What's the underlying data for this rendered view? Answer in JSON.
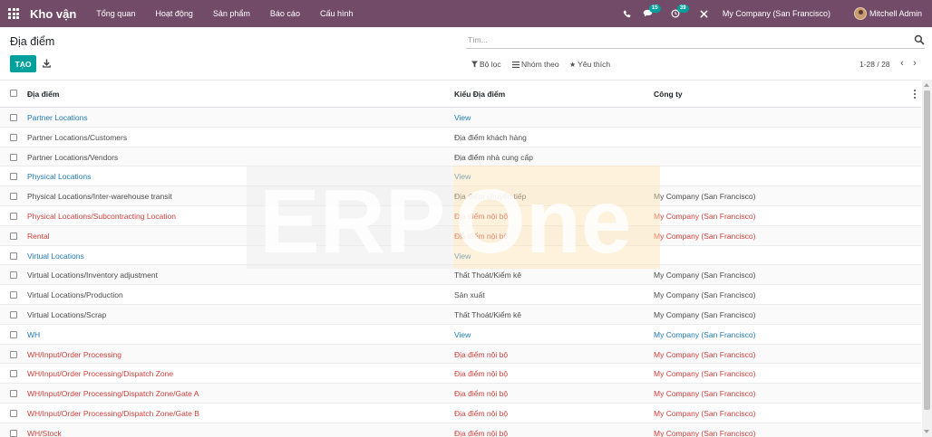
{
  "navbar": {
    "app_name": "Kho vận",
    "menu": [
      "Tổng quan",
      "Hoạt động",
      "Sản phẩm",
      "Báo cáo",
      "Cấu hình"
    ],
    "messages_count": "15",
    "activities_count": "39",
    "company": "My Company (San Francisco)",
    "user": "Mitchell Admin"
  },
  "control_panel": {
    "breadcrumb": "Địa điểm",
    "search_placeholder": "Tìm...",
    "create_label": "TẠO",
    "filters_label": "Bộ lọc",
    "group_by_label": "Nhóm theo",
    "favorites_label": "Yêu thích",
    "pager": "1-28 / 28"
  },
  "table": {
    "columns": [
      "Địa điểm",
      "Kiểu Địa điểm",
      "Công ty"
    ],
    "rows": [
      {
        "location": "Partner Locations",
        "type": "View",
        "company": "",
        "color": "#1f7ab8"
      },
      {
        "location": "Partner Locations/Customers",
        "type": "Địa điểm khách hàng",
        "company": "",
        "color": "#4c4c4c"
      },
      {
        "location": "Partner Locations/Vendors",
        "type": "Địa điểm nhà cung cấp",
        "company": "",
        "color": "#4c4c4c"
      },
      {
        "location": "Physical Locations",
        "type": "View",
        "company": "",
        "color": "#1f7ab8"
      },
      {
        "location": "Physical Locations/Inter-warehouse transit",
        "type": "Địa điểm chuyển tiếp",
        "company": "My Company (San Francisco)",
        "color": "#4c4c4c"
      },
      {
        "location": "Physical Locations/Subcontracting Location",
        "type": "Địa điểm nội bộ",
        "company": "My Company (San Francisco)",
        "color": "#d23f3a"
      },
      {
        "location": "Rental",
        "type": "Địa điểm nội bộ",
        "company": "My Company (San Francisco)",
        "color": "#d23f3a"
      },
      {
        "location": "Virtual Locations",
        "type": "View",
        "company": "",
        "color": "#1f7ab8"
      },
      {
        "location": "Virtual Locations/Inventory adjustment",
        "type": "Thất Thoát/Kiểm kê",
        "company": "My Company (San Francisco)",
        "color": "#4c4c4c"
      },
      {
        "location": "Virtual Locations/Production",
        "type": "Sản xuất",
        "company": "My Company (San Francisco)",
        "color": "#4c4c4c"
      },
      {
        "location": "Virtual Locations/Scrap",
        "type": "Thất Thoát/Kiểm kê",
        "company": "My Company (San Francisco)",
        "color": "#4c4c4c"
      },
      {
        "location": "WH",
        "type": "View",
        "company": "My Company (San Francisco)",
        "color": "#1f7ab8"
      },
      {
        "location": "WH/Input/Order Processing",
        "type": "Địa điểm nội bộ",
        "company": "My Company (San Francisco)",
        "color": "#d23f3a"
      },
      {
        "location": "WH/Input/Order Processing/Dispatch Zone",
        "type": "Địa điểm nội bộ",
        "company": "My Company (San Francisco)",
        "color": "#d23f3a"
      },
      {
        "location": "WH/Input/Order Processing/Dispatch Zone/Gate A",
        "type": "Địa điểm nội bộ",
        "company": "My Company (San Francisco)",
        "color": "#d23f3a"
      },
      {
        "location": "WH/Input/Order Processing/Dispatch Zone/Gate B",
        "type": "Địa điểm nội bộ",
        "company": "My Company (San Francisco)",
        "color": "#d23f3a"
      },
      {
        "location": "WH/Stock",
        "type": "Địa điểm nội bộ",
        "company": "My Company (San Francisco)",
        "color": "#d23f3a"
      }
    ]
  },
  "watermark": {
    "text_left": "ERP",
    "text_right": "One"
  },
  "colors": {
    "navbar": "#714B67",
    "primary": "#00A09D",
    "view_link": "#1f7ab8",
    "internal": "#d23f3a"
  },
  "icons": [
    "apps-grid-icon",
    "phone-icon",
    "chat-icon",
    "clock-icon",
    "close-icon",
    "search-icon",
    "download-icon",
    "filter-icon",
    "group-by-icon",
    "star-icon",
    "chevron-left-icon",
    "chevron-right-icon",
    "column-options-icon"
  ]
}
